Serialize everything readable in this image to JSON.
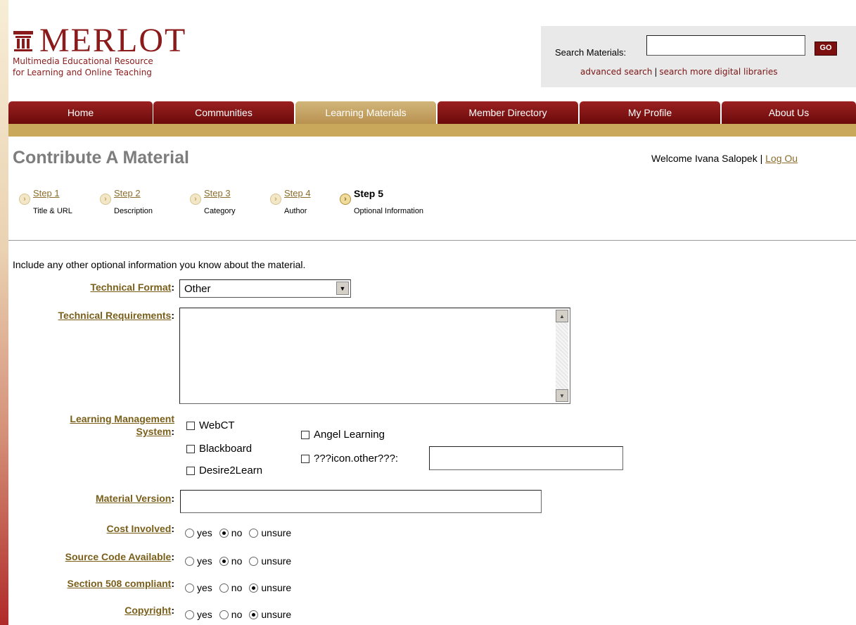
{
  "header": {
    "logo_title": "MERLOT",
    "logo_sub1": "Multimedia Educational Resource",
    "logo_sub2": "for Learning and Online Teaching",
    "search_label": "Search Materials:",
    "search_value": "",
    "go_label": "GO",
    "advanced_search": "advanced search",
    "search_more": "search more digital libraries",
    "link_sep": "|"
  },
  "nav": {
    "tabs": [
      {
        "label": "Home"
      },
      {
        "label": "Communities"
      },
      {
        "label": "Learning Materials",
        "active": true
      },
      {
        "label": "Member Directory"
      },
      {
        "label": "My Profile"
      },
      {
        "label": "About Us"
      }
    ]
  },
  "page": {
    "title": "Contribute A Material",
    "welcome_text": "Welcome Ivana Salopek |",
    "logout": "Log Ou"
  },
  "steps": [
    {
      "label": "Step 1",
      "sub": "Title & URL"
    },
    {
      "label": "Step 2",
      "sub": "Description"
    },
    {
      "label": "Step 3",
      "sub": "Category"
    },
    {
      "label": "Step 4",
      "sub": "Author"
    },
    {
      "label": "Step 5",
      "sub": "Optional Information",
      "current": true
    }
  ],
  "form": {
    "intro": "Include any other optional information you know about the material.",
    "technical_format": {
      "label": "Technical Format",
      "value": "Other"
    },
    "technical_requirements": {
      "label": "Technical Requirements",
      "value": ""
    },
    "lms": {
      "label_line1": "Learning Management",
      "label_line2": "System",
      "options": [
        "WebCT",
        "Blackboard",
        "Desire2Learn",
        "Angel Learning",
        "???icon.other???:"
      ],
      "other_value": ""
    },
    "material_version": {
      "label": "Material Version",
      "value": ""
    },
    "radio_options": [
      "yes",
      "no",
      "unsure"
    ],
    "cost_involved": {
      "label": "Cost Involved",
      "selected": "no"
    },
    "source_code": {
      "label": "Source Code Available",
      "selected": "no"
    },
    "section508": {
      "label": "Section 508 compliant",
      "selected": "unsure"
    },
    "copyright": {
      "label": "Copyright",
      "selected": "unsure"
    },
    "colon": ":"
  }
}
